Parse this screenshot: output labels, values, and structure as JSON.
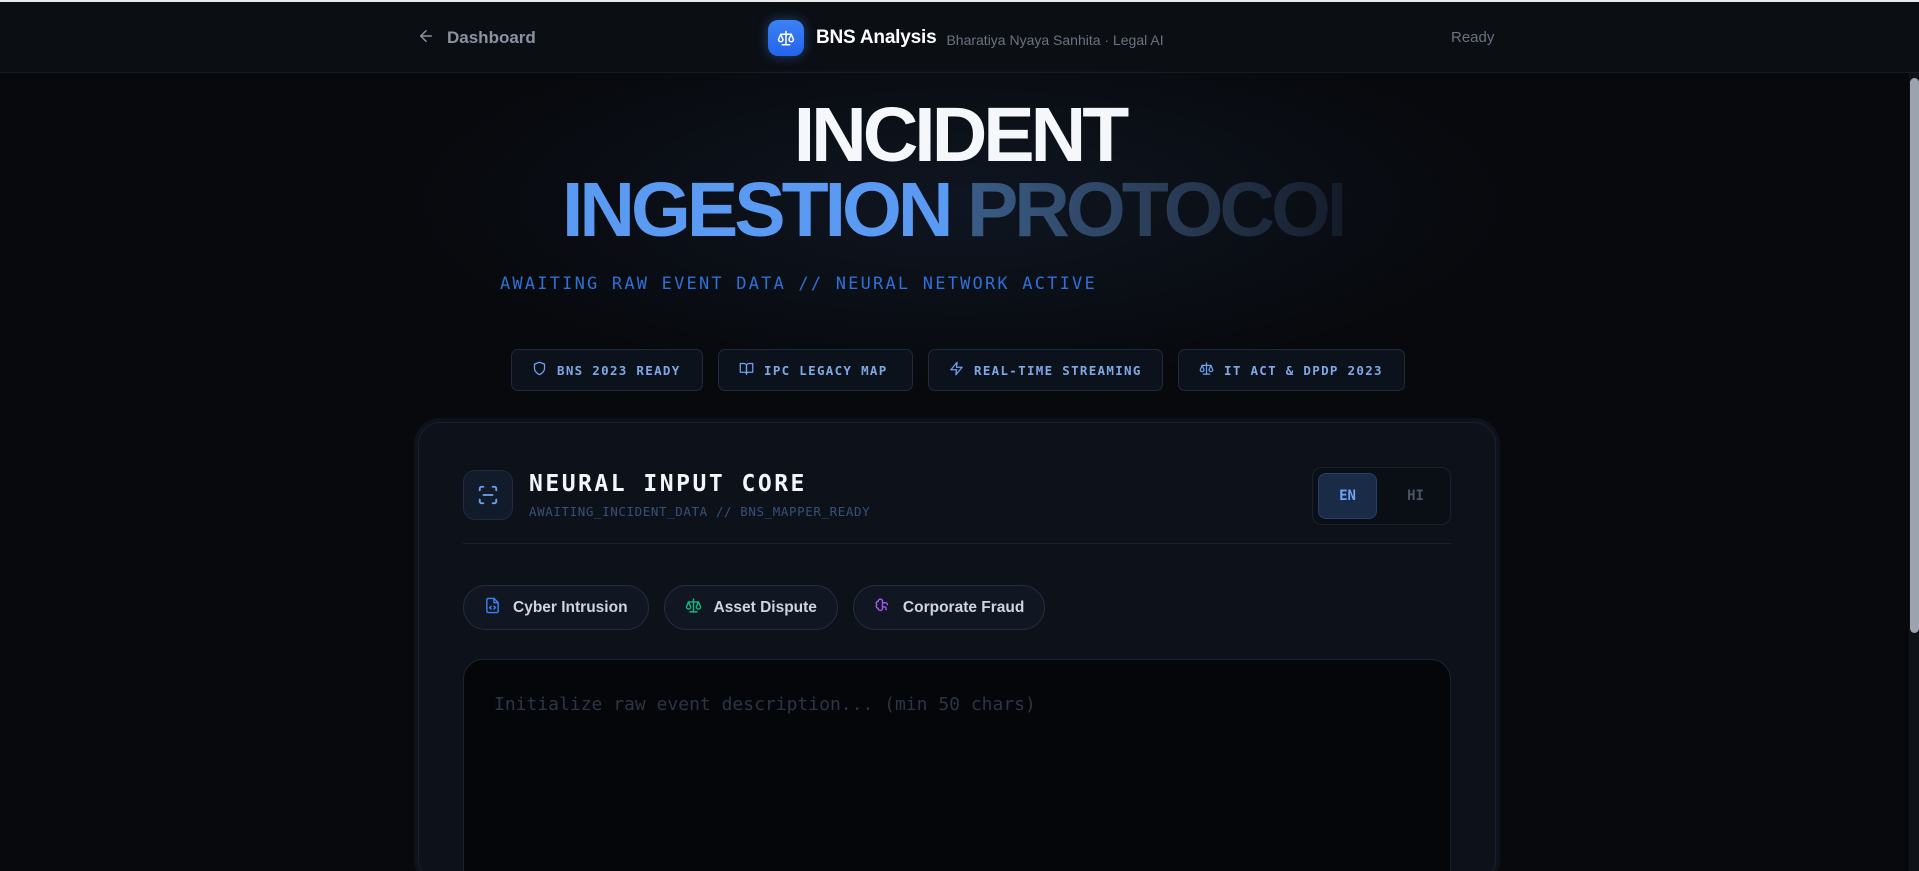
{
  "header": {
    "back_label": "Dashboard",
    "brand_title": "BNS Analysis",
    "brand_subtitle": "Bharatiya Nyaya Sanhita · Legal AI",
    "status": "Ready"
  },
  "hero": {
    "line1": "INCIDENT",
    "line2_a": "INGESTION",
    "line2_b": "PROTOCOL",
    "tagline": "AWAITING RAW EVENT DATA // NEURAL NETWORK ACTIVE"
  },
  "badges": [
    {
      "label": "BNS 2023 READY",
      "icon": "shield-icon"
    },
    {
      "label": "IPC LEGACY MAP",
      "icon": "book-icon"
    },
    {
      "label": "REAL-TIME STREAMING",
      "icon": "bolt-icon"
    },
    {
      "label": "IT ACT & DPDP 2023",
      "icon": "scale-icon"
    }
  ],
  "core": {
    "title": "NEURAL INPUT CORE",
    "subtitle": "AWAITING_INCIDENT_DATA // BNS_MAPPER_READY",
    "lang_en": "EN",
    "lang_hi": "HI",
    "selected_lang": "EN"
  },
  "chips": [
    {
      "label": "Cyber Intrusion",
      "icon": "code-file-icon",
      "color": "#3b82f6"
    },
    {
      "label": "Asset Dispute",
      "icon": "scale-icon",
      "color": "#10b981"
    },
    {
      "label": "Corporate Fraud",
      "icon": "brain-icon",
      "color": "#a855f7"
    }
  ],
  "input": {
    "placeholder": "Initialize raw event description... (min 50 chars)",
    "value": ""
  },
  "colors": {
    "accent": "#3b82f6",
    "background": "#07090d",
    "card": "#0d121a"
  }
}
